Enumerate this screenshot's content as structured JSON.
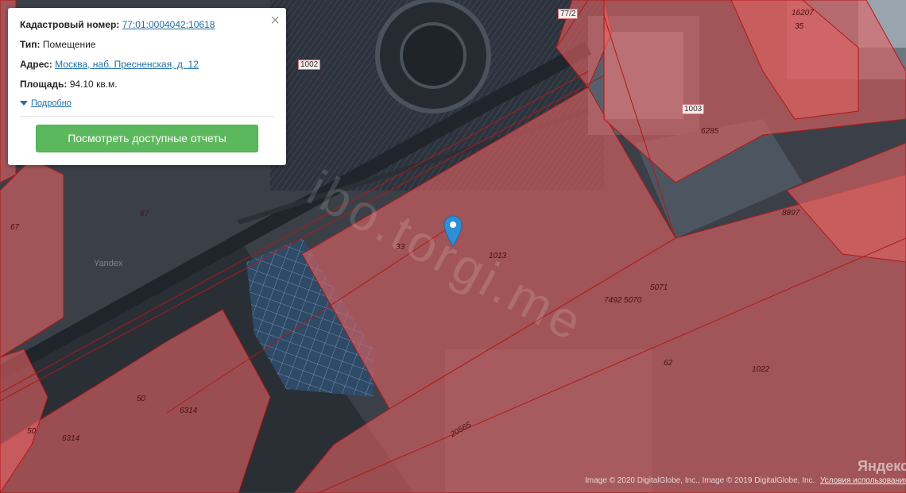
{
  "popup": {
    "cadastral_label": "Кадастровый номер:",
    "cadastral_value": "77:01:0004042:10618",
    "type_label": "Тип:",
    "type_value": "Помещение",
    "address_label": "Адрес:",
    "address_value": "Москва, наб. Пресненская, д. 12",
    "area_label": "Площадь:",
    "area_value": "94.10 кв.м.",
    "details_link": "Подробно",
    "reports_button": "Посмотреть доступные отчеты",
    "close_symbol": "×"
  },
  "parcel_labels": [
    "77/2",
    "16207",
    "35",
    "1002",
    "1003",
    "6285",
    "67",
    "67",
    "8897",
    "33",
    "1013",
    "5071",
    "7492 5070",
    "62",
    "1022",
    "50",
    "6314",
    "50",
    "6314",
    "20565"
  ],
  "watermark": "ibo.torgi.me",
  "yandex_mark": "Yandex",
  "copyright": "Image © 2020 DigitalGlobe, Inc., Image © 2019 DigitalGlobe, Inc.",
  "terms_link": "Условия использования",
  "yandex_logo": "Яндекс",
  "colors": {
    "parcel_fill": "#e06262",
    "parcel_border": "#b01818",
    "button": "#5cb85c",
    "link": "#1f6fa8"
  }
}
